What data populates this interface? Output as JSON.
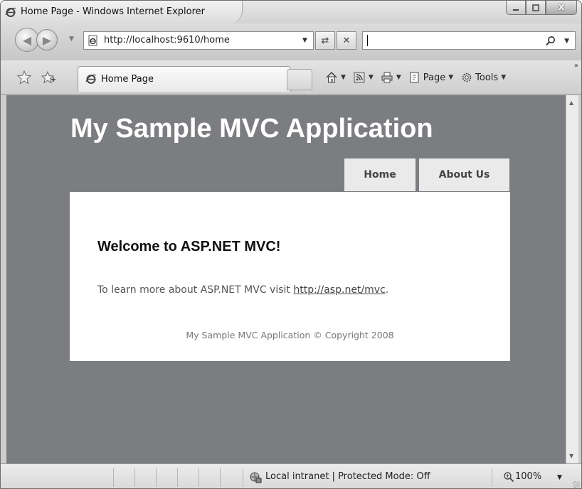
{
  "window": {
    "title": "Home Page - Windows Internet Explorer",
    "controls": {
      "minimize_icon": "minimize-icon",
      "maximize_icon": "maximize-icon",
      "close_label": "X"
    }
  },
  "navigation": {
    "back_icon": "back-arrow-icon",
    "forward_icon": "forward-arrow-icon",
    "address_url": "http://localhost:9610/home",
    "search_value": ""
  },
  "command_bar": {
    "tab_label": "Home Page",
    "page_menu": "Page",
    "tools_menu": "Tools"
  },
  "site": {
    "title": "My Sample MVC Application",
    "menu": {
      "home": "Home",
      "about": "About Us"
    },
    "heading": "Welcome to ASP.NET MVC!",
    "intro_prefix": "To learn more about ASP.NET MVC visit ",
    "intro_link": "http://asp.net/mvc",
    "intro_suffix": ".",
    "footer": "My Sample MVC Application © Copyright 2008"
  },
  "status_bar": {
    "zone": "Local intranet | Protected Mode: Off",
    "zoom": "100%"
  },
  "colors": {
    "page_background": "#7c7d80",
    "content_background": "#ffffff",
    "menu_background": "#eaeaea"
  }
}
